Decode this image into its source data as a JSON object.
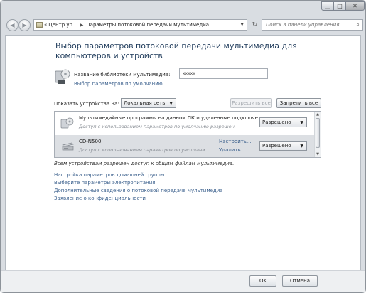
{
  "address_bar": {
    "segments": [
      "Центр уп...",
      "Параметры потоковой передачи мультимедиа"
    ],
    "prefix": "«"
  },
  "search": {
    "placeholder": "Поиск в панели управления"
  },
  "page": {
    "title": "Выбор параметров потоковой передачи мультимедиа для компьютеров и устройств",
    "library_name_label": "Название библиотеки мультимедиа:",
    "library_name_value": "xxxxx",
    "library_defaults_link": "Выбор параметров по умолчанию...",
    "show_devices_label": "Показать устройства на:",
    "show_devices_value": "Локальная сеть",
    "allow_all": "Разрешить все",
    "block_all": "Запретить все",
    "devices": [
      {
        "name": "Мультимедийные программы на данном ПК и удаленные подключе...",
        "description": "Доступ с использованием параметров по умолчанию разрешен.",
        "status": "Разрешено",
        "link1": "",
        "link2": ""
      },
      {
        "name": "CD-N500",
        "description": "Доступ с использованием параметров по умолчани...",
        "status": "Разрешено",
        "link1": "Настроить...",
        "link2": "Удалить..."
      }
    ],
    "note": "Всем устройствам разрешен доступ к общим файлам мультимедиа.",
    "links": [
      "Настройка параметров домашней группы",
      "Выберите параметры электропитания",
      "Дополнительные сведения о потоковой передаче мультимедиа",
      "Заявление о конфиденциальности"
    ]
  },
  "footer": {
    "ok": "OK",
    "cancel": "Отмена"
  },
  "colors": {
    "link": "#3a5f8c",
    "title": "#1e3a5a",
    "selected_row": "#dcdfe3"
  }
}
